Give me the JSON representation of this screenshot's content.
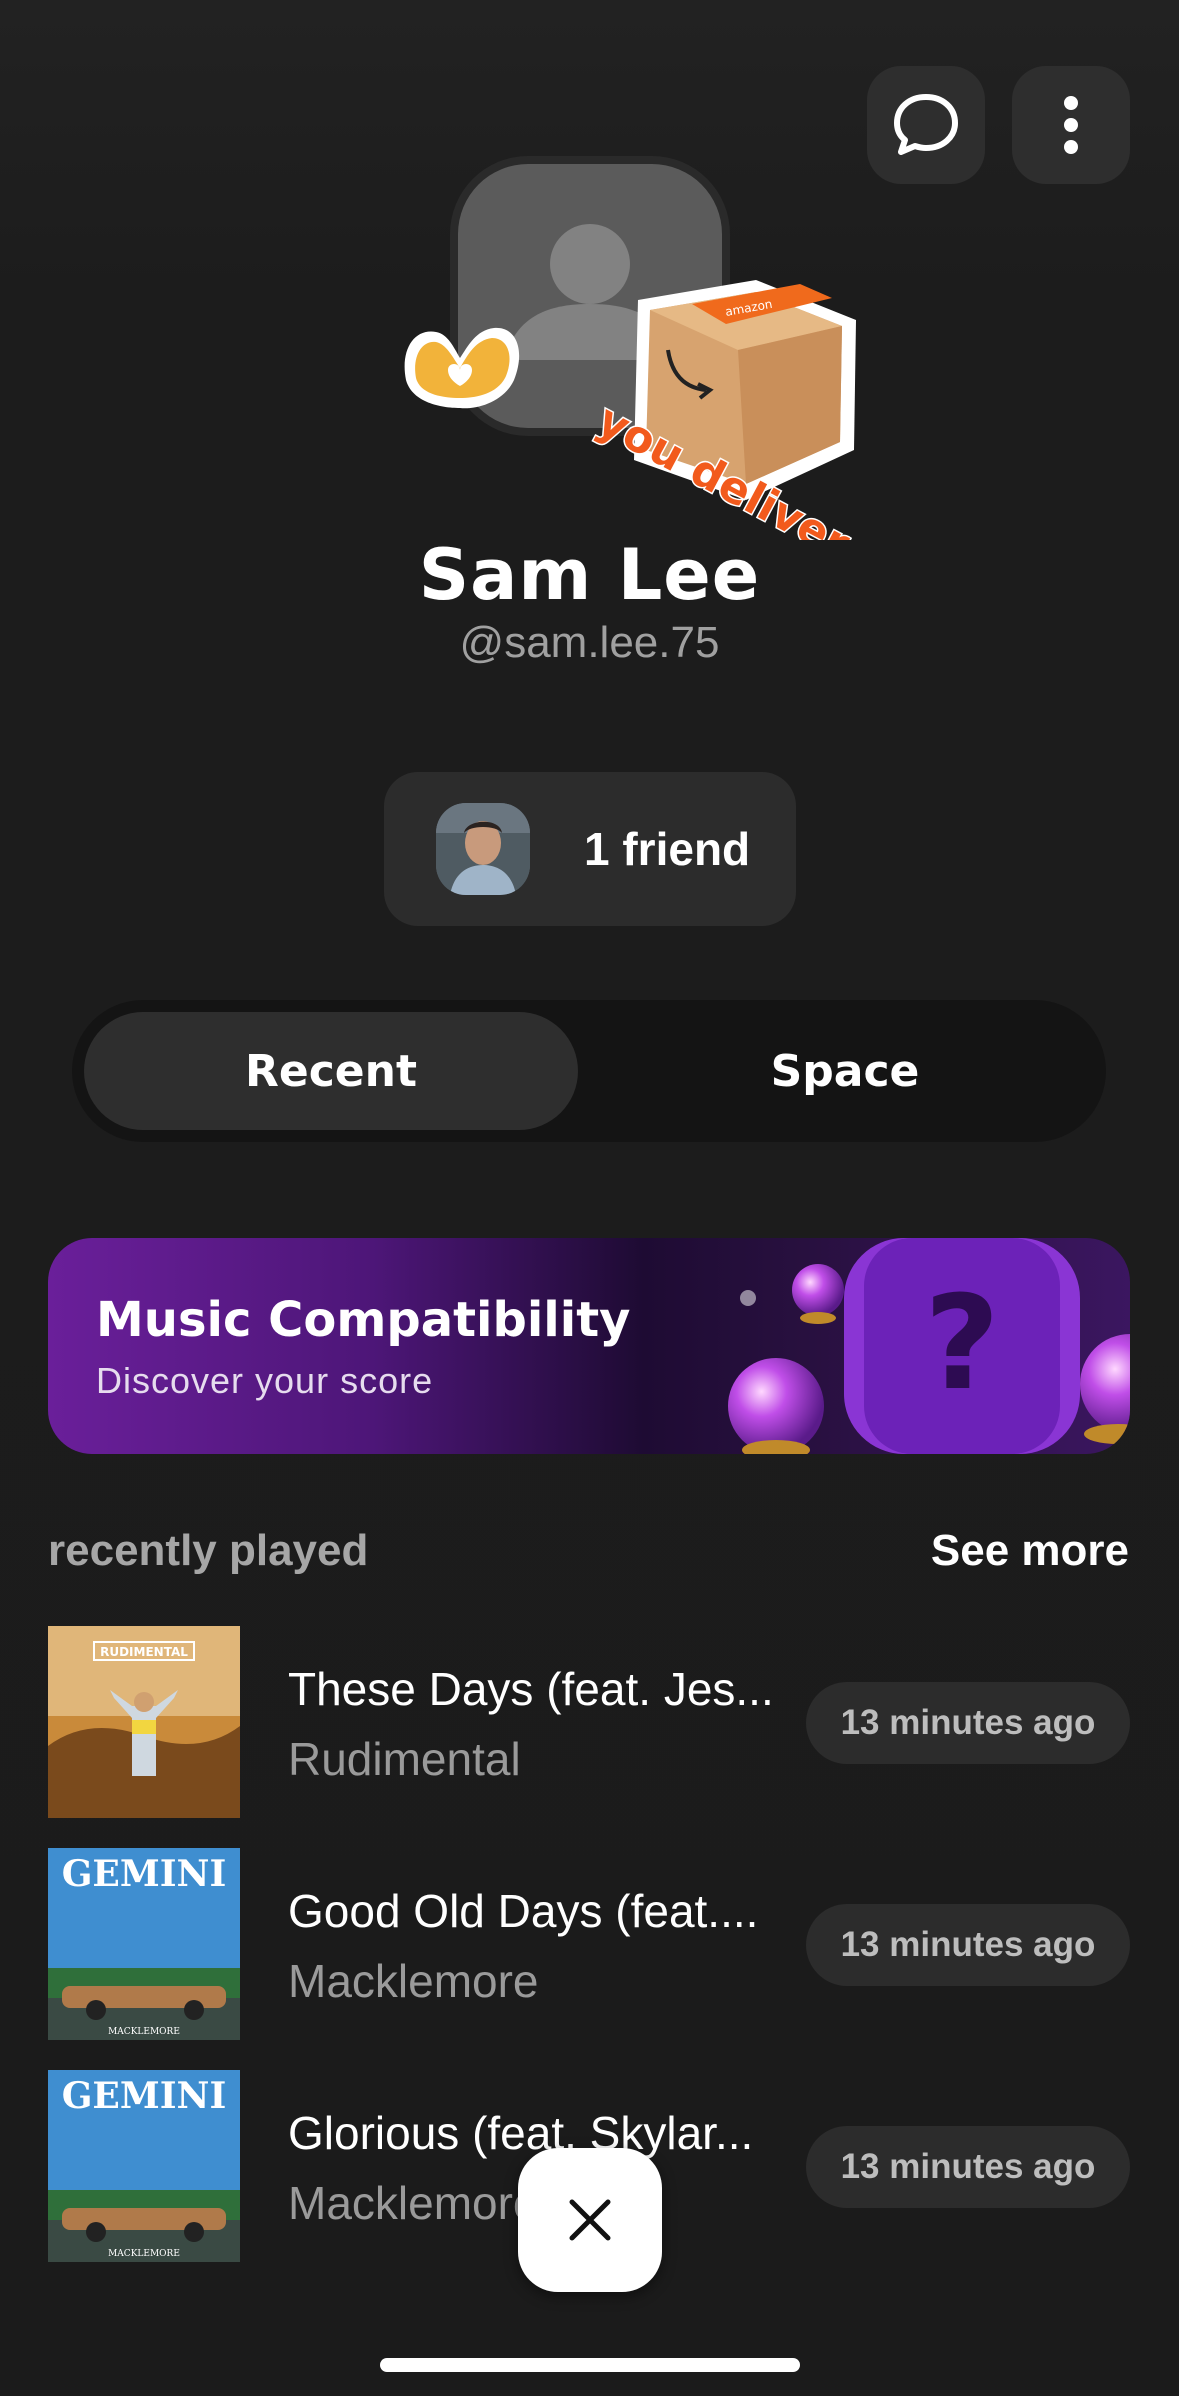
{
  "header": {
    "chat_icon": "chat-bubble-icon",
    "more_icon": "more-vertical-icon"
  },
  "profile": {
    "name": "Sam Lee",
    "handle": "@sam.lee.75",
    "avatar_icon": "person-placeholder-icon",
    "stickers": {
      "box_text": "you delivered",
      "box_brand": "amazon"
    }
  },
  "friends": {
    "label": "1 friend"
  },
  "tabs": [
    {
      "label": "Recent",
      "selected": true
    },
    {
      "label": "Space",
      "selected": false
    }
  ],
  "banner": {
    "title": "Music Compatibility",
    "subtitle": "Discover your score",
    "art_symbol": "?"
  },
  "recently_played": {
    "title": "recently played",
    "see_more": "See more",
    "tracks": [
      {
        "title": "These Days (feat. Jes...",
        "artist": "Rudimental",
        "time": "13 minutes ago",
        "cover_text": "RUDIMENTAL"
      },
      {
        "title": "Good Old Days (feat....",
        "artist": "Macklemore",
        "time": "13 minutes ago",
        "cover_text": "GEMINI",
        "cover_sub": "MACKLEMORE"
      },
      {
        "title": "Glorious (feat. Skylar...",
        "artist": "Macklemore",
        "time": "13 minutes ago",
        "cover_text": "GEMINI",
        "cover_sub": "MACKLEMORE"
      }
    ]
  },
  "close_icon": "close-icon",
  "colors": {
    "background": "#1c1c1c",
    "surface": "#2c2c2c",
    "banner_purple": "#6a1f9a"
  }
}
